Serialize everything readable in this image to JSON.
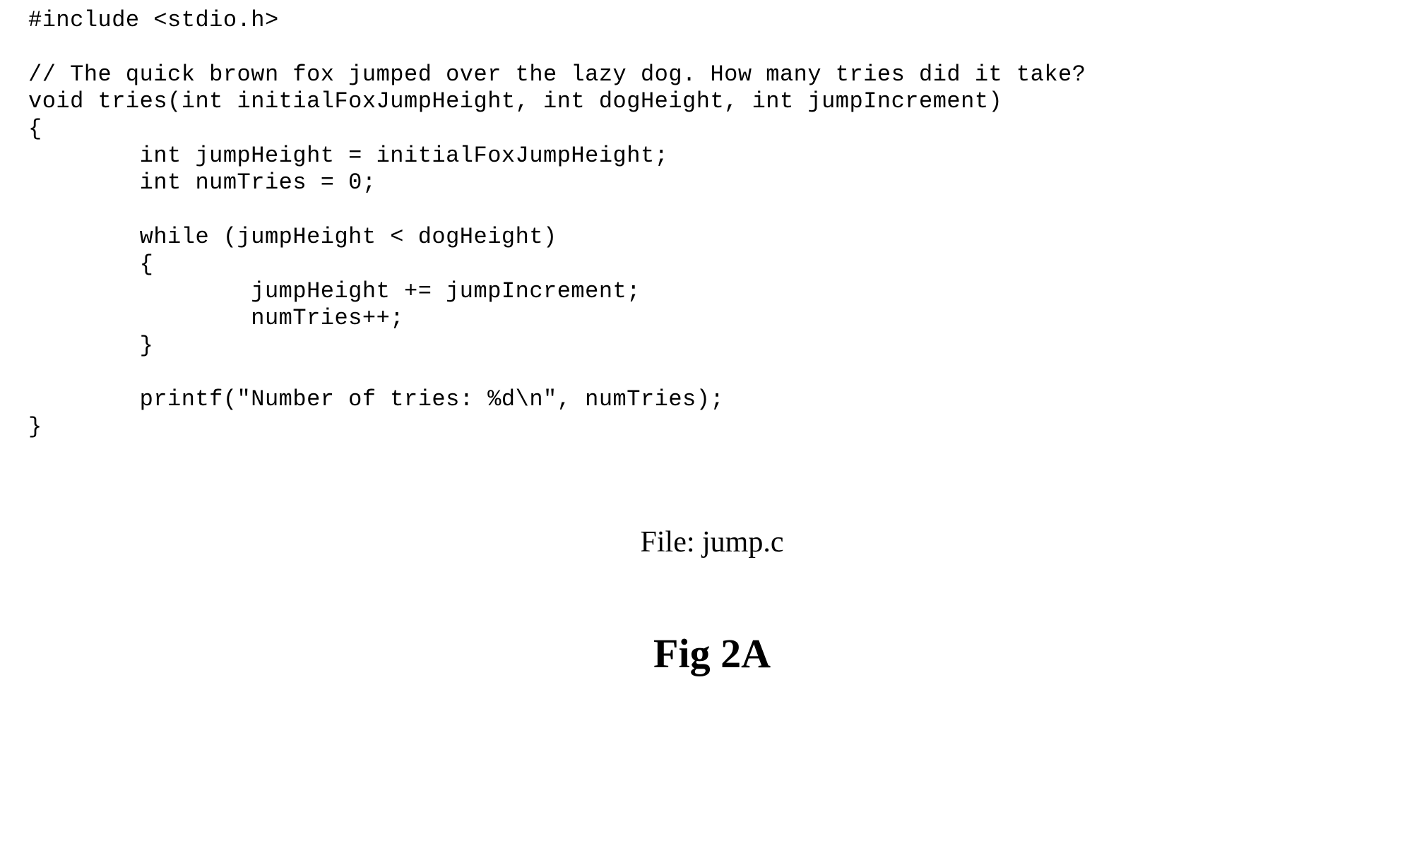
{
  "code": {
    "line1": "#include <stdio.h>",
    "line2": "",
    "line3": "// The quick brown fox jumped over the lazy dog. How many tries did it take?",
    "line4": "void tries(int initialFoxJumpHeight, int dogHeight, int jumpIncrement)",
    "line5": "{",
    "line6": "        int jumpHeight = initialFoxJumpHeight;",
    "line7": "        int numTries = 0;",
    "line8": "",
    "line9": "        while (jumpHeight < dogHeight)",
    "line10": "        {",
    "line11": "                jumpHeight += jumpIncrement;",
    "line12": "                numTries++;",
    "line13": "        }",
    "line14": "",
    "line15": "        printf(\"Number of tries: %d\\n\", numTries);",
    "line16": "}"
  },
  "file_label": "File: jump.c",
  "figure_label": "Fig 2A"
}
